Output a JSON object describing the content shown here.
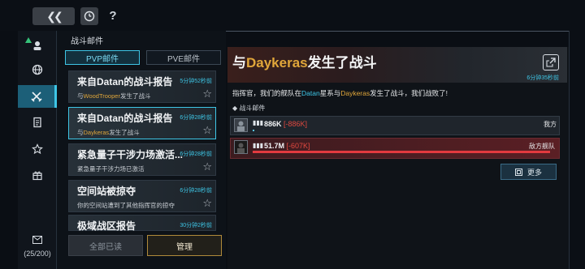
{
  "topbar": {
    "back_icon": "double-chevron-left-icon",
    "clock_icon": "clock-icon",
    "help_label": "?"
  },
  "sidebar": {
    "items": [
      {
        "icon": "commander-icon",
        "active": false
      },
      {
        "icon": "globe-icon",
        "active": false
      },
      {
        "icon": "crossed-swords-icon",
        "active": true
      },
      {
        "icon": "document-icon",
        "active": false
      },
      {
        "icon": "star-icon",
        "active": false
      },
      {
        "icon": "gift-icon",
        "active": false
      }
    ],
    "mail_count": "(25/200)"
  },
  "panel": {
    "title": "战斗邮件",
    "tabs": [
      {
        "label": "PVP邮件",
        "active": true
      },
      {
        "label": "PVE邮件",
        "active": false
      }
    ],
    "reports": [
      {
        "title": "来自Datan的战斗报告",
        "time": "5分钟52秒前",
        "sub_prefix": "与",
        "sub_highlight": "WoodTrooper",
        "sub_suffix": "发生了战斗",
        "selected": false
      },
      {
        "title": "来自Datan的战斗报告",
        "time": "6分钟28秒前",
        "sub_prefix": "与",
        "sub_highlight": "Daykeras",
        "sub_suffix": "发生了战斗",
        "selected": true
      },
      {
        "title": "紧急量子干涉力场激活...",
        "time": "6分钟28秒前",
        "sub_prefix": "紧急量子干涉力场已激活",
        "sub_highlight": "",
        "sub_suffix": "",
        "selected": false
      },
      {
        "title": "空间站被掠夺",
        "time": "6分钟28秒前",
        "sub_prefix": "你的空间站遭到了其他指挥官的掠夺",
        "sub_highlight": "",
        "sub_suffix": "",
        "selected": false
      },
      {
        "title": "极域战区报告",
        "time": "30分钟2秒前",
        "sub_prefix": "",
        "sub_highlight": "",
        "sub_suffix": "",
        "selected": false
      }
    ],
    "read_all_label": "全部已读",
    "manage_label": "管理"
  },
  "detail": {
    "title_prefix": "与",
    "title_highlight": "Daykeras",
    "title_suffix": "发生了战斗",
    "time": "6分钟35秒前",
    "body_1": "指挥官，我们的舰队在",
    "body_planet": "Datan",
    "body_2": "星系与",
    "body_enemy": "Daykeras",
    "body_3": "发生了战斗，我们战败了!",
    "section_label": "战斗邮件",
    "ally": {
      "power": "886K",
      "loss": "[-886K]",
      "label": "我方",
      "remaining_fraction": 0.0
    },
    "enemy": {
      "power": "51.7M",
      "loss": "[-607K]",
      "label": "敌方舰队",
      "remaining_fraction": 0.988
    },
    "more_label": "更多"
  },
  "colors": {
    "accent": "#3ec6e6",
    "highlight": "#e0a63a",
    "loss": "#e0483f",
    "enemy_bar": "#e23a3f"
  }
}
